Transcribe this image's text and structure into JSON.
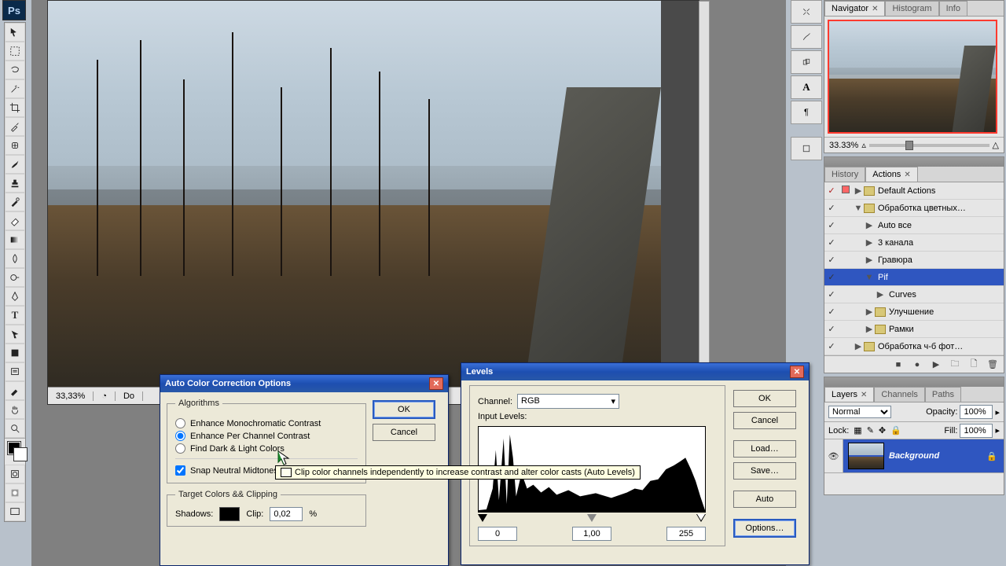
{
  "app": {
    "badge": "Ps"
  },
  "document": {
    "zoom": "33,33%",
    "status_prefix": "Do"
  },
  "panels": {
    "navigator": {
      "tabs": [
        "Navigator",
        "Histogram",
        "Info"
      ],
      "zoom": "33.33%"
    },
    "actions": {
      "tabs": [
        "History",
        "Actions"
      ],
      "items": [
        {
          "label": "Default Actions",
          "indent": 0,
          "check": true,
          "red": true,
          "expand": "▶",
          "folder": true
        },
        {
          "label": "Обработка цветных…",
          "indent": 0,
          "check": true,
          "red": false,
          "expand": "▼",
          "folder": true
        },
        {
          "label": "Auto все",
          "indent": 1,
          "check": true,
          "expand": "▶"
        },
        {
          "label": "3 канала",
          "indent": 1,
          "check": true,
          "expand": "▶"
        },
        {
          "label": "Гравюра",
          "indent": 1,
          "check": true,
          "expand": "▶"
        },
        {
          "label": "Pif",
          "indent": 1,
          "check": true,
          "expand": "▼",
          "selected": true
        },
        {
          "label": "Curves",
          "indent": 2,
          "check": true,
          "expand": "▶"
        },
        {
          "label": "Улучшение",
          "indent": 1,
          "check": true,
          "expand": "▶",
          "folder": true
        },
        {
          "label": "Рамки",
          "indent": 1,
          "check": true,
          "expand": "▶",
          "folder": true
        },
        {
          "label": "Обработка ч-б фот…",
          "indent": 0,
          "check": true,
          "expand": "▶",
          "folder": true
        }
      ]
    },
    "layers": {
      "tabs": [
        "Layers",
        "Channels",
        "Paths"
      ],
      "blend": "Normal",
      "opacity_label": "Opacity:",
      "opacity_value": "100%",
      "lock_label": "Lock:",
      "fill_label": "Fill:",
      "fill_value": "100%",
      "layer_name": "Background"
    }
  },
  "dialog_autocolor": {
    "title": "Auto Color Correction Options",
    "group_algorithms": "Algorithms",
    "radio1": "Enhance Monochromatic Contrast",
    "radio2": "Enhance Per Channel Contrast",
    "radio3": "Find Dark & Light Colors",
    "check_snap": "Snap Neutral Midtones",
    "group_target": "Target Colors && Clipping",
    "shadows_label": "Shadows:",
    "clip_label": "Clip:",
    "clip_value": "0,02",
    "clip_unit": "%",
    "ok": "OK",
    "cancel": "Cancel",
    "tooltip": "Clip color channels independently to increase contrast and alter color casts (Auto Levels)"
  },
  "dialog_levels": {
    "title": "Levels",
    "channel_label": "Channel:",
    "channel_value": "RGB",
    "input_levels_label": "Input Levels:",
    "val_black": "0",
    "val_mid": "1,00",
    "val_white": "255",
    "ok": "OK",
    "cancel": "Cancel",
    "load": "Load…",
    "save": "Save…",
    "auto": "Auto",
    "options": "Options…"
  }
}
